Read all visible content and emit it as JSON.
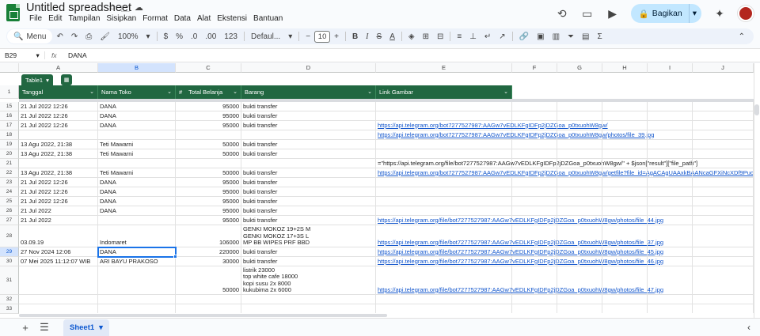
{
  "header": {
    "title": "Untitled spreadsheet",
    "menu": [
      "File",
      "Edit",
      "Tampilan",
      "Sisipkan",
      "Format",
      "Data",
      "Alat",
      "Ekstensi",
      "Bantuan"
    ],
    "share_label": "Bagikan"
  },
  "toolbar": {
    "menu_label": "Menu",
    "zoom": "100%",
    "currency": "$",
    "percent": "%",
    "dec_decrease": ".0",
    "dec_increase": ".00",
    "number_format": "123",
    "font": "Defaul...",
    "font_size": "10",
    "bold": "B",
    "italic": "I",
    "strike": "S",
    "text_color": "A",
    "functions": "Σ"
  },
  "formula_bar": {
    "name_box": "B29",
    "fx": "fx",
    "value": "DANA"
  },
  "columns": [
    "A",
    "B",
    "C",
    "D",
    "E",
    "F",
    "G",
    "H",
    "I",
    "J"
  ],
  "table": {
    "name": "Table1",
    "headers": [
      "Tanggal",
      "Nama Toko",
      "Total Belanja",
      "Barang",
      "Link Gambar"
    ],
    "hash_symbol": "#"
  },
  "rows": [
    {
      "num": "15",
      "a": "21 Jul 2022 12:26",
      "b": "DANA",
      "c": "95000",
      "d": "bukti transfer",
      "e": ""
    },
    {
      "num": "16",
      "a": "21 Jul 2022 12:26",
      "b": "DANA",
      "c": "95000",
      "d": "bukti transfer",
      "e": ""
    },
    {
      "num": "17",
      "a": "21 Jul 2022 12:26",
      "b": "DANA",
      "c": "95000",
      "d": "bukti transfer",
      "e": "https://api.telegram.org/bot7277527987:AAGw7vEDLKFgIDFp2jDZGoa_p0txuohW8gw/"
    },
    {
      "num": "18",
      "a": "",
      "b": "",
      "c": "",
      "d": "",
      "e": "https://api.telegram.org/bot7277527987:AAGw7vEDLKFgIDFp2jDZGoa_p0txuohW8gw/photos/file_39.jpg"
    },
    {
      "num": "19",
      "a": "13 Agu 2022, 21:38",
      "b": "Teti Mawarni",
      "c": "50000",
      "d": "bukti transfer",
      "e": ""
    },
    {
      "num": "20",
      "a": "13 Agu 2022, 21:38",
      "b": "Teti Mawarni",
      "c": "50000",
      "d": "bukti transfer",
      "e": ""
    },
    {
      "num": "21",
      "a": "",
      "b": "",
      "c": "",
      "d": "",
      "e": "=\"https://api.telegram.org/file/bot7277527987:AAGw7vEDLKFgIDFp2jDZGoa_p0txuohW8gw/\" + $json[\"result\"][\"file_path\"]"
    },
    {
      "num": "22",
      "a": "13 Agu 2022, 21:38",
      "b": "Teti Mawarni",
      "c": "50000",
      "d": "bukti transfer",
      "e": "https://api.telegram.org/bot7277527987:AAGw7vEDLKFgIDFp2jDZGoa_p0txuohW8gw/getfile?file_id=AgACAgUAAxkBAANcaGFXiNcXDf9Puo"
    },
    {
      "num": "23",
      "a": "21 Jul 2022 12:26",
      "b": "DANA",
      "c": "95000",
      "d": "bukti transfer",
      "e": ""
    },
    {
      "num": "24",
      "a": "21 Jul 2022 12:26",
      "b": "DANA",
      "c": "95000",
      "d": "bukti transfer",
      "e": ""
    },
    {
      "num": "25",
      "a": "21 Jul 2022 12:26",
      "b": "DANA",
      "c": "95000",
      "d": "bukti transfer",
      "e": ""
    },
    {
      "num": "26",
      "a": "21 Jul 2022",
      "b": "DANA",
      "c": "95000",
      "d": "bukti transfer",
      "e": ""
    },
    {
      "num": "27",
      "a": "21 Jul 2022",
      "b": "",
      "c": "95000",
      "d": "bukti transfer",
      "e": "https://api.telegram.org/file/bot7277527987:AAGw7vEDLKFgIDFp2jDZGoa_p0txuohW8gw/photos/file_44.jpg"
    },
    {
      "num": "28",
      "a": "03.09.19",
      "b": "Indomaret",
      "c": "106000",
      "d": "GENKI MOKOZ 19+2S M\nGENKI MOKOZ 17+3S L\nMP BB WIPES PRF BBD",
      "e": "https://api.telegram.org/file/bot7277527987:AAGw7vEDLKFgIDFp2jDZGoa_p0txuohW8gw/photos/file_37.jpg"
    },
    {
      "num": "29",
      "a": "27 Nov 2024 12:06",
      "b": "DANA",
      "c": "220000",
      "d": "bukti transfer",
      "e": "https://api.telegram.org/file/bot7277527987:AAGw7vEDLKFgIDFp2jDZGoa_p0txuohW8gw/photos/file_45.jpg"
    },
    {
      "num": "30",
      "a": "07 Mei 2025 11:12:07 WIB",
      "b": "ARI BAYU PRAKOSO",
      "c": "30000",
      "d": "bukti transfer",
      "e": "https://api.telegram.org/file/bot7277527987:AAGw7vEDLKFgIDFp2jDZGoa_p0txuohW8gw/photos/file_46.jpg"
    },
    {
      "num": "31",
      "a": "",
      "b": "",
      "c": "50000",
      "d": "listrik 23000\ntop white cafe 18000\nkopi susu 2x 8000\nkukubima 2x 6000",
      "e": "https://api.telegram.org/file/bot7277527987:AAGw7vEDLKFgIDFp2jDZGoa_p0txuohW8gw/photos/file_47.jpg"
    },
    {
      "num": "32",
      "a": "",
      "b": "",
      "c": "",
      "d": "",
      "e": ""
    },
    {
      "num": "33",
      "a": "",
      "b": "",
      "c": "",
      "d": "",
      "e": ""
    }
  ],
  "bottom": {
    "add": "+",
    "sheet_name": "Sheet1"
  },
  "colors": {
    "table_green": "#216741",
    "link_blue": "#1155cc",
    "selection_blue": "#1a73e8",
    "share_bg": "#c2e7ff"
  }
}
